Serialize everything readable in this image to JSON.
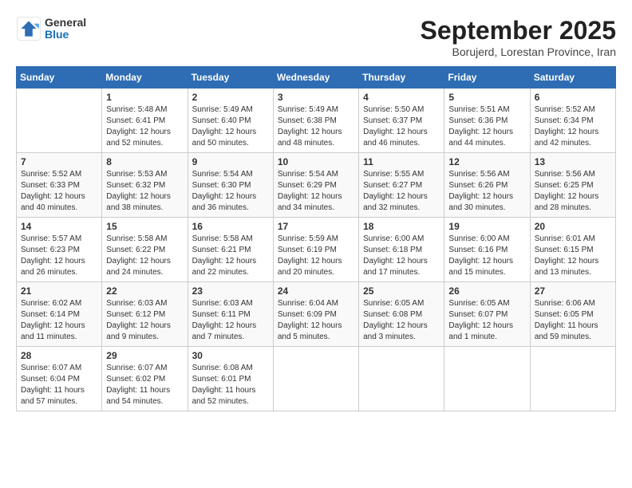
{
  "header": {
    "logo_general": "General",
    "logo_blue": "Blue",
    "month": "September 2025",
    "location": "Borujerd, Lorestan Province, Iran"
  },
  "weekdays": [
    "Sunday",
    "Monday",
    "Tuesday",
    "Wednesday",
    "Thursday",
    "Friday",
    "Saturday"
  ],
  "weeks": [
    [
      {
        "day": "",
        "info": ""
      },
      {
        "day": "1",
        "info": "Sunrise: 5:48 AM\nSunset: 6:41 PM\nDaylight: 12 hours\nand 52 minutes."
      },
      {
        "day": "2",
        "info": "Sunrise: 5:49 AM\nSunset: 6:40 PM\nDaylight: 12 hours\nand 50 minutes."
      },
      {
        "day": "3",
        "info": "Sunrise: 5:49 AM\nSunset: 6:38 PM\nDaylight: 12 hours\nand 48 minutes."
      },
      {
        "day": "4",
        "info": "Sunrise: 5:50 AM\nSunset: 6:37 PM\nDaylight: 12 hours\nand 46 minutes."
      },
      {
        "day": "5",
        "info": "Sunrise: 5:51 AM\nSunset: 6:36 PM\nDaylight: 12 hours\nand 44 minutes."
      },
      {
        "day": "6",
        "info": "Sunrise: 5:52 AM\nSunset: 6:34 PM\nDaylight: 12 hours\nand 42 minutes."
      }
    ],
    [
      {
        "day": "7",
        "info": "Sunrise: 5:52 AM\nSunset: 6:33 PM\nDaylight: 12 hours\nand 40 minutes."
      },
      {
        "day": "8",
        "info": "Sunrise: 5:53 AM\nSunset: 6:32 PM\nDaylight: 12 hours\nand 38 minutes."
      },
      {
        "day": "9",
        "info": "Sunrise: 5:54 AM\nSunset: 6:30 PM\nDaylight: 12 hours\nand 36 minutes."
      },
      {
        "day": "10",
        "info": "Sunrise: 5:54 AM\nSunset: 6:29 PM\nDaylight: 12 hours\nand 34 minutes."
      },
      {
        "day": "11",
        "info": "Sunrise: 5:55 AM\nSunset: 6:27 PM\nDaylight: 12 hours\nand 32 minutes."
      },
      {
        "day": "12",
        "info": "Sunrise: 5:56 AM\nSunset: 6:26 PM\nDaylight: 12 hours\nand 30 minutes."
      },
      {
        "day": "13",
        "info": "Sunrise: 5:56 AM\nSunset: 6:25 PM\nDaylight: 12 hours\nand 28 minutes."
      }
    ],
    [
      {
        "day": "14",
        "info": "Sunrise: 5:57 AM\nSunset: 6:23 PM\nDaylight: 12 hours\nand 26 minutes."
      },
      {
        "day": "15",
        "info": "Sunrise: 5:58 AM\nSunset: 6:22 PM\nDaylight: 12 hours\nand 24 minutes."
      },
      {
        "day": "16",
        "info": "Sunrise: 5:58 AM\nSunset: 6:21 PM\nDaylight: 12 hours\nand 22 minutes."
      },
      {
        "day": "17",
        "info": "Sunrise: 5:59 AM\nSunset: 6:19 PM\nDaylight: 12 hours\nand 20 minutes."
      },
      {
        "day": "18",
        "info": "Sunrise: 6:00 AM\nSunset: 6:18 PM\nDaylight: 12 hours\nand 17 minutes."
      },
      {
        "day": "19",
        "info": "Sunrise: 6:00 AM\nSunset: 6:16 PM\nDaylight: 12 hours\nand 15 minutes."
      },
      {
        "day": "20",
        "info": "Sunrise: 6:01 AM\nSunset: 6:15 PM\nDaylight: 12 hours\nand 13 minutes."
      }
    ],
    [
      {
        "day": "21",
        "info": "Sunrise: 6:02 AM\nSunset: 6:14 PM\nDaylight: 12 hours\nand 11 minutes."
      },
      {
        "day": "22",
        "info": "Sunrise: 6:03 AM\nSunset: 6:12 PM\nDaylight: 12 hours\nand 9 minutes."
      },
      {
        "day": "23",
        "info": "Sunrise: 6:03 AM\nSunset: 6:11 PM\nDaylight: 12 hours\nand 7 minutes."
      },
      {
        "day": "24",
        "info": "Sunrise: 6:04 AM\nSunset: 6:09 PM\nDaylight: 12 hours\nand 5 minutes."
      },
      {
        "day": "25",
        "info": "Sunrise: 6:05 AM\nSunset: 6:08 PM\nDaylight: 12 hours\nand 3 minutes."
      },
      {
        "day": "26",
        "info": "Sunrise: 6:05 AM\nSunset: 6:07 PM\nDaylight: 12 hours\nand 1 minute."
      },
      {
        "day": "27",
        "info": "Sunrise: 6:06 AM\nSunset: 6:05 PM\nDaylight: 11 hours\nand 59 minutes."
      }
    ],
    [
      {
        "day": "28",
        "info": "Sunrise: 6:07 AM\nSunset: 6:04 PM\nDaylight: 11 hours\nand 57 minutes."
      },
      {
        "day": "29",
        "info": "Sunrise: 6:07 AM\nSunset: 6:02 PM\nDaylight: 11 hours\nand 54 minutes."
      },
      {
        "day": "30",
        "info": "Sunrise: 6:08 AM\nSunset: 6:01 PM\nDaylight: 11 hours\nand 52 minutes."
      },
      {
        "day": "",
        "info": ""
      },
      {
        "day": "",
        "info": ""
      },
      {
        "day": "",
        "info": ""
      },
      {
        "day": "",
        "info": ""
      }
    ]
  ]
}
